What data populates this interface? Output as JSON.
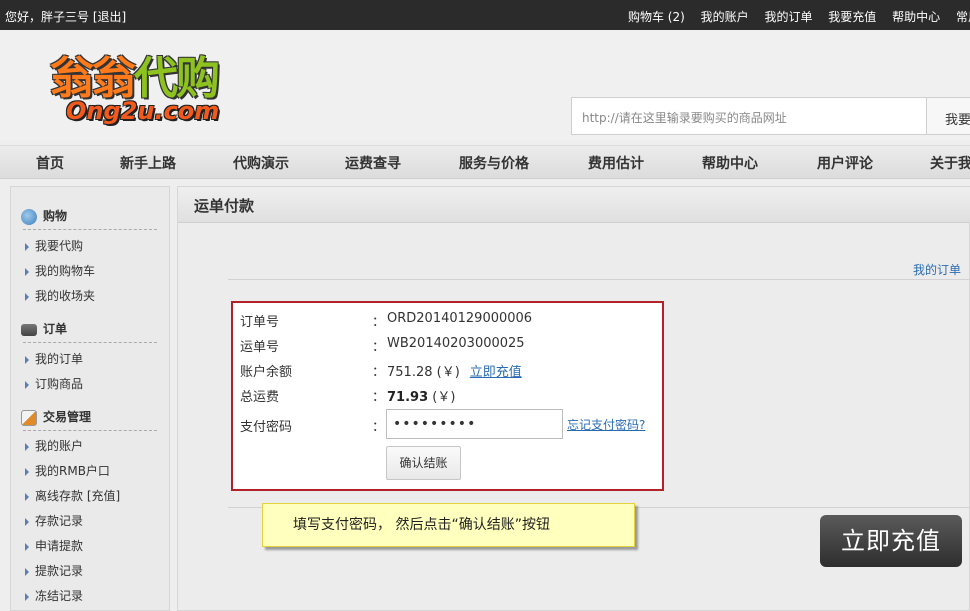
{
  "topbar": {
    "greeting": "您好，胖子三号",
    "logout": "[退出]",
    "links": [
      "购物车 (2)",
      "我的账户",
      "我的订单",
      "我要充值",
      "帮助中心",
      "常用"
    ]
  },
  "header": {
    "logo_cn_1": "翁翁",
    "logo_cn_2": "代购",
    "logo_en": "Ong2u.com",
    "search_placeholder": "http://请在这里输录要购买的商品网址",
    "search_button": "我要"
  },
  "nav": [
    "首页",
    "新手上路",
    "代购演示",
    "运费查寻",
    "服务与价格",
    "费用估计",
    "帮助中心",
    "用户评论",
    "关于我"
  ],
  "sidebar": {
    "sections": [
      {
        "title": "购物",
        "items": [
          "我要代购",
          "我的购物车",
          "我的收场夹"
        ]
      },
      {
        "title": "订单",
        "items": [
          "我的订单",
          "订购商品"
        ]
      },
      {
        "title": "交易管理",
        "items": [
          "我的账户",
          "我的RMB户口",
          "离线存款 [充值]",
          "存款记录",
          "申请提款",
          "提款记录",
          "冻结记录"
        ]
      }
    ]
  },
  "content": {
    "title": "运单付款",
    "my_orders_link": "我的订单",
    "form": {
      "order_no_label": "订单号",
      "order_no": "ORD20140129000006",
      "waybill_label": "运单号",
      "waybill": "WB20140203000025",
      "balance_label": "账户余额",
      "balance": "751.28 (￥)",
      "recharge_link": "立即充值",
      "total_label": "总运费",
      "total": "71.93",
      "total_unit": " (￥)",
      "password_label": "支付密码",
      "password_value": "•••••••••",
      "forgot_link": "忘记支付密码?",
      "confirm_button": "确认结账",
      "colon": "："
    },
    "tip": "填写支付密码， 然后点击“确认结账”按钮",
    "recharge_button": "立即充值"
  },
  "colors": {
    "highlight_border": "#b3222a",
    "link": "#2a6cb3",
    "tip_bg": "#ffffbe"
  }
}
